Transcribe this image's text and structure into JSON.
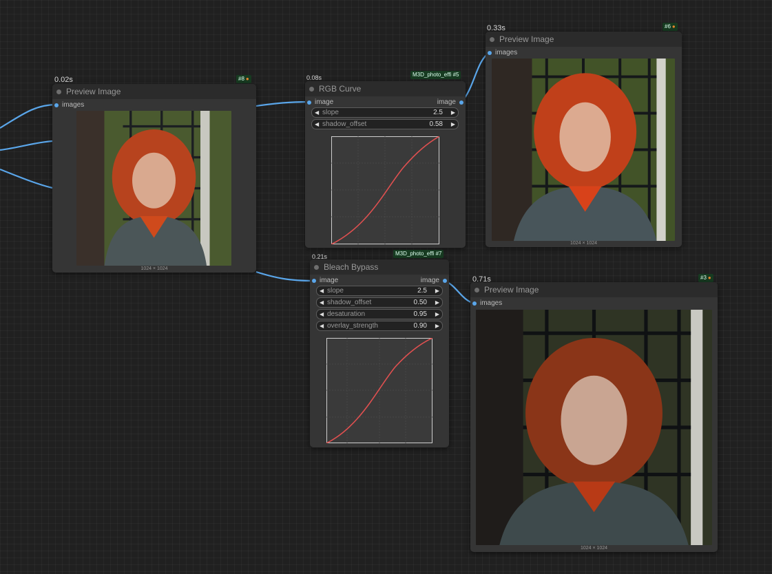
{
  "nodes": {
    "preview8": {
      "time": "0.02s",
      "title": "Preview Image",
      "badge_id": "#8",
      "input": "images",
      "dims": "1024 × 1024"
    },
    "rgbcurve": {
      "time": "0.08s",
      "title": "RGB Curve",
      "badge_pack": "M3D_photo_effi",
      "badge_id": "#5",
      "input": "image",
      "output": "image",
      "widgets": [
        {
          "name": "slope",
          "value": "2.5"
        },
        {
          "name": "shadow_offset",
          "value": "0.58"
        }
      ]
    },
    "preview6": {
      "time": "0.33s",
      "title": "Preview Image",
      "badge_id": "#6",
      "input": "images",
      "dims": "1024 × 1024"
    },
    "bleach": {
      "time": "0.21s",
      "title": "Bleach Bypass",
      "badge_pack": "M3D_photo_effi",
      "badge_id": "#7",
      "input": "image",
      "output": "image",
      "widgets": [
        {
          "name": "slope",
          "value": "2.5"
        },
        {
          "name": "shadow_offset",
          "value": "0.50"
        },
        {
          "name": "desaturation",
          "value": "0.95"
        },
        {
          "name": "overlay_strength",
          "value": "0.90"
        }
      ]
    },
    "preview3": {
      "time": "0.71s",
      "title": "Preview Image",
      "badge_id": "#3",
      "input": "images",
      "dims": "1024 × 1024"
    }
  },
  "icons": {
    "badge": "fox-icon",
    "widget_left": "arrow-left-icon",
    "widget_right": "arrow-right-icon"
  },
  "colors": {
    "link": "#5aa6ea",
    "curve": "#e05050",
    "badge_bg": "#173b21"
  }
}
